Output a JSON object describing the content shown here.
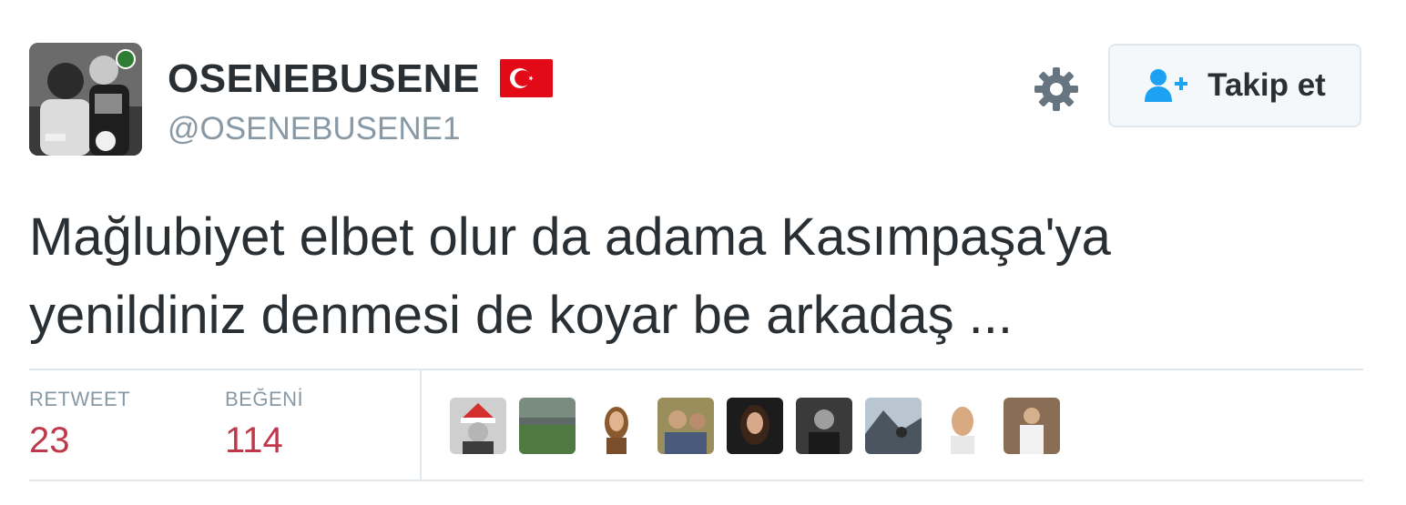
{
  "user": {
    "display_name": "OSENEBUSENE",
    "handle": "@OSENEBUSENE1"
  },
  "follow_button": {
    "label": "Takip et"
  },
  "tweet": {
    "text_line1": "Mağlubiyet elbet olur da adama Kasımpaşa'ya",
    "text_line2": "yenildiniz denmesi de koyar be arkadaş ..."
  },
  "stats": {
    "retweet_label": "RETWEET",
    "retweet_count": "23",
    "like_label": "BEĞENİ",
    "like_count": "114"
  },
  "icons": [
    "flag-icon",
    "gear-icon",
    "follow-user-icon"
  ],
  "colors": {
    "count_red": "#c0394b",
    "follow_blue": "#1da1f2",
    "muted_gray": "#8899a6",
    "flag_red": "#e30a17"
  }
}
